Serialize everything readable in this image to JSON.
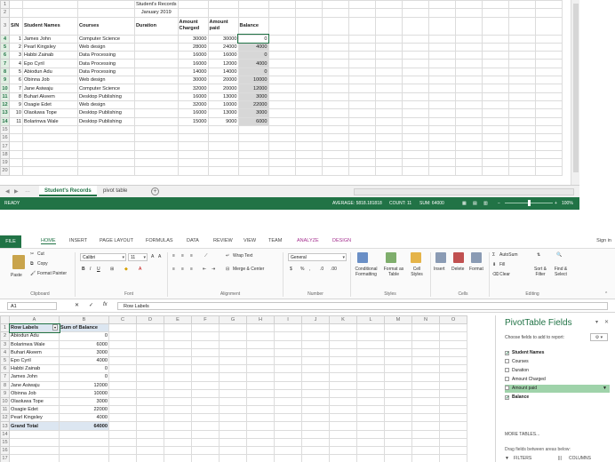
{
  "top_sheet": {
    "title": "Student's Records",
    "subtitle": "January 2019",
    "headers": [
      "S/N",
      "Student Names",
      "Courses",
      "Duration",
      "Amount Charged",
      "Amount paid",
      "Balance"
    ],
    "header_lines": {
      "amount_charged": [
        "Amount",
        "Charged"
      ],
      "amount_paid": [
        "Amount",
        "paid"
      ]
    },
    "rows": [
      {
        "sn": "1",
        "name": "James John",
        "course": "Computer Science",
        "charged": "30000",
        "paid": "30000",
        "balance": "0"
      },
      {
        "sn": "2",
        "name": "Pearl Kingsley",
        "course": "Web design",
        "charged": "28000",
        "paid": "24000",
        "balance": "4000"
      },
      {
        "sn": "3",
        "name": "Habbi Zainab",
        "course": "Data Processing",
        "charged": "16000",
        "paid": "16000",
        "balance": "0"
      },
      {
        "sn": "4",
        "name": "Epo Cyril",
        "course": "Data Processing",
        "charged": "16000",
        "paid": "12000",
        "balance": "4000"
      },
      {
        "sn": "5",
        "name": "Abiodun Adu",
        "course": "Data Processing",
        "charged": "14000",
        "paid": "14000",
        "balance": "0"
      },
      {
        "sn": "6",
        "name": "Obinna Job",
        "course": "Web design",
        "charged": "30000",
        "paid": "20000",
        "balance": "10000"
      },
      {
        "sn": "7",
        "name": "Jane Asiwaju",
        "course": "Computer Science",
        "charged": "32000",
        "paid": "20000",
        "balance": "12000"
      },
      {
        "sn": "8",
        "name": "Buhari Akeem",
        "course": "Desktop Publishing",
        "charged": "16000",
        "paid": "13000",
        "balance": "3000"
      },
      {
        "sn": "9",
        "name": "Osagie Edet",
        "course": "Web design",
        "charged": "32000",
        "paid": "10000",
        "balance": "22000"
      },
      {
        "sn": "10",
        "name": "Olaoluwa Tope",
        "course": "Desktop Publishing",
        "charged": "16000",
        "paid": "13000",
        "balance": "3000"
      },
      {
        "sn": "11",
        "name": "Bolarinwa Wale",
        "course": "Desktop Publishing",
        "charged": "15000",
        "paid": "9000",
        "balance": "6000"
      }
    ],
    "row_numbers": [
      "1",
      "2",
      "3",
      "4",
      "5",
      "6",
      "7",
      "8",
      "9",
      "10",
      "11",
      "12",
      "13",
      "14",
      "15",
      "16",
      "17",
      "18",
      "19",
      "20"
    ],
    "tabs": {
      "active": "Student's Records",
      "other": "pivot table",
      "add": "+"
    },
    "status": {
      "ready": "READY",
      "average": "AVERAGE: 5818.181818",
      "count": "COUNT: 11",
      "sum": "SUM: 64000",
      "zoom": "100%"
    }
  },
  "ribbon": {
    "tabs": [
      "FILE",
      "HOME",
      "INSERT",
      "PAGE LAYOUT",
      "FORMULAS",
      "DATA",
      "REVIEW",
      "VIEW",
      "TEAM",
      "ANALYZE",
      "DESIGN"
    ],
    "sign_in": "Sign in",
    "clipboard": {
      "cut": "Cut",
      "copy": "Copy",
      "paste": "Paste",
      "format_painter": "Format Painter",
      "label": "Clipboard"
    },
    "font": {
      "name": "Calibri",
      "size": "11",
      "label": "Font"
    },
    "alignment": {
      "wrap_text": "Wrap Text",
      "merge_center": "Merge & Center",
      "label": "Alignment"
    },
    "number": {
      "format": "General",
      "label": "Number"
    },
    "styles": {
      "conditional": "Conditional Formatting",
      "format_table": "Format as Table",
      "cell_styles": "Cell Styles",
      "label": "Styles"
    },
    "cells": {
      "insert": "Insert",
      "delete": "Delete",
      "format": "Format",
      "label": "Cells"
    },
    "editing": {
      "autosum": "AutoSum",
      "fill": "Fill",
      "clear": "Clear",
      "sort": "Sort & Filter",
      "find": "Find & Select",
      "label": "Editing"
    }
  },
  "formula_bar": {
    "name_box": "A1",
    "fx": "fx",
    "value": "Row Labels"
  },
  "bottom_sheet": {
    "columns": [
      "A",
      "B",
      "C",
      "D",
      "E",
      "F",
      "G",
      "H",
      "I",
      "J",
      "K",
      "L",
      "M",
      "N",
      "O"
    ],
    "row_numbers": [
      "1",
      "2",
      "3",
      "4",
      "5",
      "6",
      "7",
      "8",
      "9",
      "10",
      "11",
      "12",
      "13",
      "14",
      "15",
      "16",
      "17"
    ],
    "pivot": {
      "header_label": "Row Labels",
      "header_value": "Sum of Balance",
      "rows": [
        {
          "label": "Abiodun Adu",
          "value": "0"
        },
        {
          "label": "Bolarinwa Wale",
          "value": "6000"
        },
        {
          "label": "Buhari Akeem",
          "value": "3000"
        },
        {
          "label": "Epo Cyril",
          "value": "4000"
        },
        {
          "label": "Habbi Zainab",
          "value": "0"
        },
        {
          "label": "James John",
          "value": "0"
        },
        {
          "label": "Jane Asiwaju",
          "value": "12000"
        },
        {
          "label": "Obinna Job",
          "value": "10000"
        },
        {
          "label": "Olaoluwa Tope",
          "value": "3000"
        },
        {
          "label": "Osagie Edet",
          "value": "22000"
        },
        {
          "label": "Pearl Kingsley",
          "value": "4000"
        }
      ],
      "total_label": "Grand Total",
      "total_value": "64000"
    }
  },
  "pivot_pane": {
    "title": "PivotTable Fields",
    "choose": "Choose fields to add to report:",
    "fields": [
      {
        "name": "Student Names",
        "checked": true,
        "bold": true,
        "highlight": false
      },
      {
        "name": "Courses",
        "checked": false,
        "bold": false,
        "highlight": false
      },
      {
        "name": "Duration",
        "checked": false,
        "bold": false,
        "highlight": false
      },
      {
        "name": "Amount Charged",
        "checked": false,
        "bold": false,
        "highlight": false
      },
      {
        "name": "Amount paid",
        "checked": false,
        "bold": false,
        "highlight": true
      },
      {
        "name": "Balance",
        "checked": true,
        "bold": true,
        "highlight": false
      }
    ],
    "more_tables": "MORE TABLES...",
    "drag_hint": "Drag fields between areas below:",
    "filters": "FILTERS",
    "columns": "COLUMNS"
  },
  "colors": {
    "excel_green": "#217346",
    "pivot_header": "#dce6f1",
    "highlight": "#9fd3aa"
  }
}
